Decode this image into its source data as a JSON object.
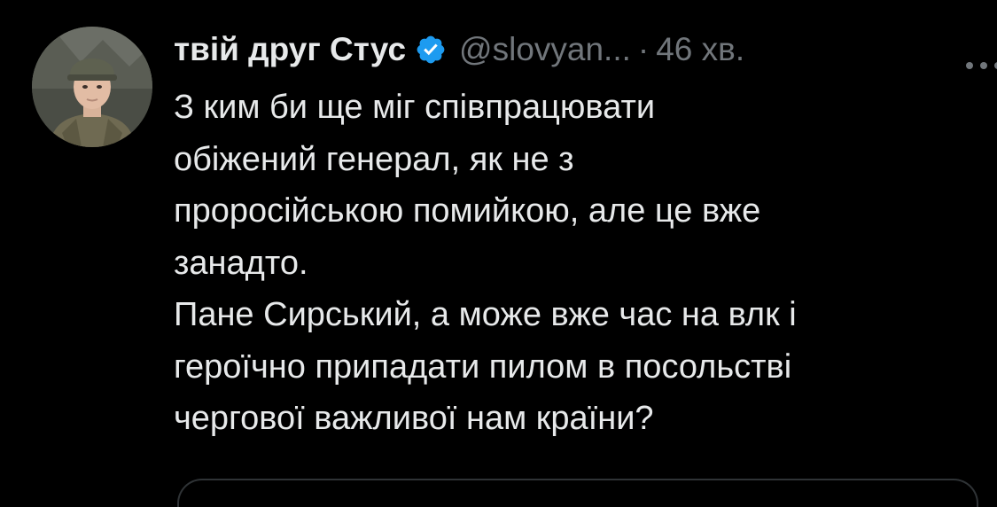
{
  "tweet": {
    "author": {
      "display_name": "твій друг Стус",
      "handle": "@slovyan...",
      "verified": true,
      "avatar": "avatar-soldier-helmet"
    },
    "separator": "·",
    "time": "46 хв.",
    "more_icon": "more-horizontal-icon",
    "text_lines": [
      "З ким би ще міг співпрацювати",
      "обіжений генерал, як не з",
      "проросійською помийкою, але це вже",
      "занадто.",
      "Пане Сирський, а може вже час на влк і",
      "героїчно припадати пилом в посольстві",
      "чергової важливої нам країни?"
    ]
  },
  "colors": {
    "background": "#000000",
    "text_primary": "#e7e9ea",
    "text_secondary": "#71767b",
    "verified_blue": "#1d9bf0",
    "border": "#2f3336"
  }
}
